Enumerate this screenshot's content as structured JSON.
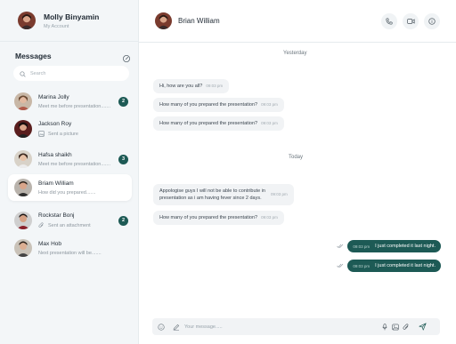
{
  "user": {
    "name": "Molly Binyamin",
    "subtitle": "My Account"
  },
  "sidebar": {
    "title": "Messages",
    "search_placeholder": "Search",
    "contacts": [
      {
        "name": "Marina Jolly",
        "preview": "Meet me before presentation.......",
        "badge": "2",
        "preview_icon": ""
      },
      {
        "name": "Jackson Roy",
        "preview": "Sent a picture",
        "badge": "",
        "preview_icon": "image-icon"
      },
      {
        "name": "Hafsa shaikh",
        "preview": "Meet me before presentation.......",
        "badge": "3",
        "preview_icon": ""
      },
      {
        "name": "Briam William",
        "preview": "How did you prepared.......",
        "badge": "",
        "preview_icon": ""
      },
      {
        "name": "Rockstar Bonj",
        "preview": "Sent an attachment",
        "badge": "2",
        "preview_icon": "paperclip-icon"
      },
      {
        "name": "Max Hob",
        "preview": "Next presentation will be.......",
        "badge": "",
        "preview_icon": ""
      }
    ]
  },
  "chat": {
    "contact_name": "Brian William",
    "day_labels": [
      "Yesterday",
      "Today"
    ],
    "messages": [
      {
        "text": "Hi, how are you all?",
        "time": "09:03 pm"
      },
      {
        "text": "How many of you prepared the presentation?",
        "time": "09:03 pm"
      },
      {
        "text": "How many of you prepared the presentation?",
        "time": "09:03 pm"
      },
      {
        "text_line1": "Appologise guys I will not be able to contribute in",
        "text_line2": "presentation as i am having fever since 2 days.",
        "time": "09:03 pm"
      },
      {
        "text": "How many of you prepared the presentation?",
        "time": "09:03 pm"
      }
    ],
    "outgoing": [
      {
        "text": "I just completed it last night.",
        "time": "09:03 pm"
      },
      {
        "text": "I just completed it last night.",
        "time": "09:03 pm"
      }
    ],
    "composer_placeholder": "Your message....."
  },
  "colors": {
    "accent": "#1d5a55",
    "sidebar_bg": "#f3f6f8",
    "bubble_bg": "#f1f3f5"
  },
  "icons": [
    "edit-icon",
    "search-icon",
    "phone-icon",
    "video-icon",
    "info-icon",
    "double-check-icon",
    "emoji-icon",
    "pen-icon",
    "mic-icon",
    "image-icon",
    "paperclip-icon",
    "send-icon"
  ]
}
